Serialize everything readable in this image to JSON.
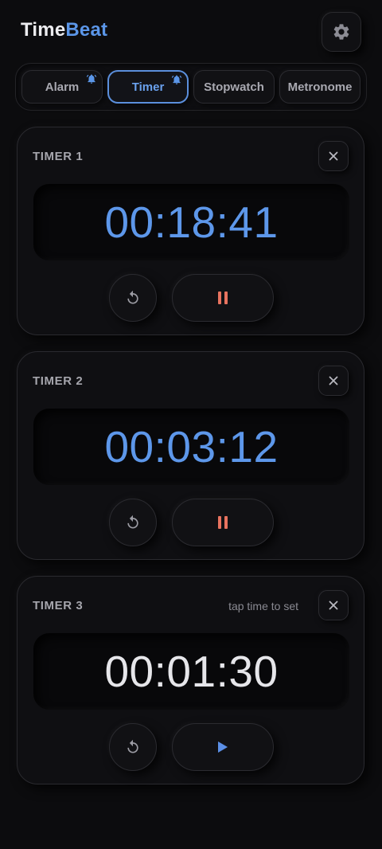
{
  "app": {
    "brand_part1": "Time",
    "brand_part2": "Beat",
    "accent_color": "#5b96e8",
    "settings_icon": "gear-icon"
  },
  "tabs": [
    {
      "label": "Alarm",
      "active": false,
      "has_bell": true
    },
    {
      "label": "Timer",
      "active": true,
      "has_bell": true
    },
    {
      "label": "Stopwatch",
      "active": false,
      "has_bell": false
    },
    {
      "label": "Metronome",
      "active": false,
      "has_bell": false
    }
  ],
  "timers": [
    {
      "title": "TIMER 1",
      "hint": "",
      "time": "00:18:41",
      "state": "running",
      "primary_icon": "pause-icon"
    },
    {
      "title": "TIMER 2",
      "hint": "",
      "time": "00:03:12",
      "state": "running",
      "primary_icon": "pause-icon"
    },
    {
      "title": "TIMER 3",
      "hint": "tap time to set",
      "time": "00:01:30",
      "state": "idle",
      "primary_icon": "play-icon"
    }
  ],
  "colors": {
    "running_time": "#5d97ea",
    "idle_time": "#e6e6ea",
    "pause": "#e8735f",
    "play": "#5b8fe6"
  }
}
